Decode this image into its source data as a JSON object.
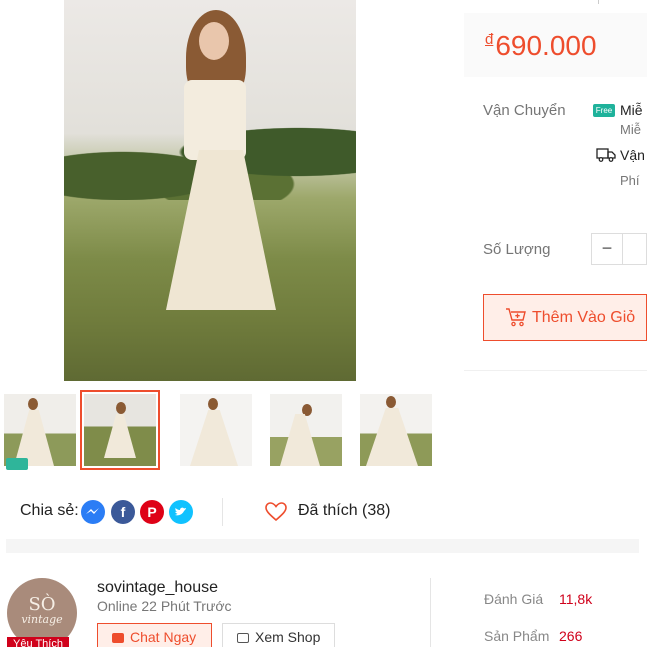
{
  "product": {
    "price_currency": "đ",
    "price_value": "690.000"
  },
  "shipping": {
    "label": "Vận Chuyển",
    "free_badge": "Free",
    "line1": "Miễ",
    "line1_sub": "Miễ",
    "line2": "Vận",
    "line2_sub": "Phí"
  },
  "quantity": {
    "label": "Số Lượng",
    "minus": "−"
  },
  "actions": {
    "add_to_cart": "Thêm Vào Giỏ"
  },
  "share": {
    "label": "Chia sẻ:",
    "icons": [
      "messenger-icon",
      "facebook-icon",
      "pinterest-icon",
      "twitter-icon"
    ],
    "liked_label": "Đã thích (38)"
  },
  "shop": {
    "favorite_tag": "Yêu Thích",
    "avatar_line1": "SÒ",
    "avatar_line2": "vintage",
    "name": "sovintage_house",
    "online": "Online 22 Phút Trước",
    "chat_button": "Chat Ngay",
    "view_shop_button": "Xem Shop",
    "stats": [
      {
        "label": "Đánh Giá",
        "value": "11,8k"
      },
      {
        "label": "Sản Phẩm",
        "value": "266"
      }
    ]
  },
  "gallery": {
    "thumbnail_count": 5,
    "active_index": 1
  },
  "colors": {
    "accent": "#ee4d2d",
    "accent_bg": "#ffeee8",
    "favorite_red": "#d0011b",
    "free_ship_teal": "#1fb29b"
  }
}
